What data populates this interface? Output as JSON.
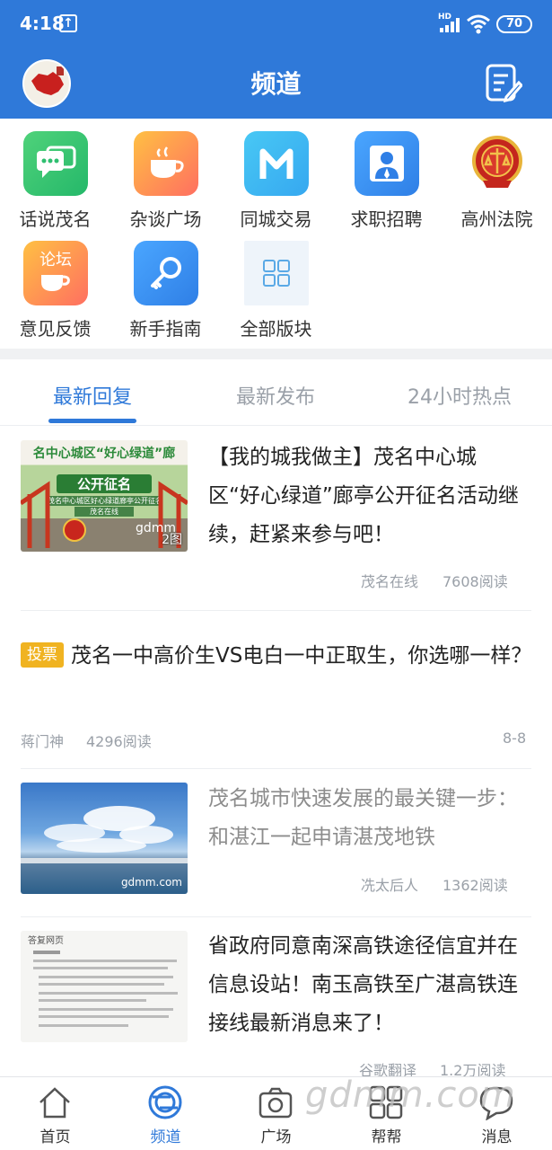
{
  "status_bar": {
    "time": "4:18",
    "network": "HD",
    "battery": "70"
  },
  "header": {
    "title": "频道"
  },
  "channels": [
    {
      "label": "话说茂名",
      "icon": "chat-bubbles-icon"
    },
    {
      "label": "杂谈广场",
      "icon": "coffee-cup-icon"
    },
    {
      "label": "同城交易",
      "icon": "m-logo-icon"
    },
    {
      "label": "求职招聘",
      "icon": "job-seeker-icon"
    },
    {
      "label": "高州法院",
      "icon": "court-emblem-icon"
    },
    {
      "label": "意见反馈",
      "icon": "forum-icon",
      "icon_text": "论坛"
    },
    {
      "label": "新手指南",
      "icon": "key-icon"
    },
    {
      "label": "全部版块",
      "icon": "grid-icon"
    }
  ],
  "tabs": [
    {
      "label": "最新回复",
      "active": true
    },
    {
      "label": "最新发布",
      "active": false
    },
    {
      "label": "24小时热点",
      "active": false
    }
  ],
  "feed": [
    {
      "title": "【我的城我做主】茂名中心城区“好心绿道”廊亭公开征名活动继续，赶紧来参与吧！",
      "author": "茂名在线",
      "reads": "7608阅读",
      "thumb": {
        "banner": "名中心城区“好心绿道”廊",
        "caption": "公开征名",
        "sub1": "茂名中心城区好心绿道廊亭公开征名",
        "sub2": "茂名在线",
        "watermark": "gdmm",
        "count": "2图"
      }
    },
    {
      "tag": "投票",
      "title": "茂名一中高价生VS电白一中正取生，你选哪一样？",
      "author": "蒋门神",
      "reads": "4296阅读",
      "date": "8-8"
    },
    {
      "title": "茂名城市快速发展的最关键一步：和湛江一起申请湛茂地铁",
      "author": "冼太后人",
      "reads": "1362阅读",
      "thumb": {
        "watermark": "gdmm.com"
      }
    },
    {
      "title": "省政府同意南深高铁途径信宜并在信息设站！南玉高铁至广湛高铁连接线最新消息来了！",
      "author": "谷歌翻译",
      "reads": "1.2万阅读",
      "thumb": {
        "heading": "答复网页"
      }
    }
  ],
  "bottom_nav": [
    {
      "label": "首页",
      "icon": "home-icon",
      "active": false
    },
    {
      "label": "频道",
      "icon": "channel-icon",
      "active": true
    },
    {
      "label": "广场",
      "icon": "camera-icon",
      "active": false
    },
    {
      "label": "帮帮",
      "icon": "apps-icon",
      "active": false
    },
    {
      "label": "消息",
      "icon": "message-icon",
      "active": false
    }
  ],
  "watermark": "gdmm.com",
  "colors": {
    "primary": "#2f79d9",
    "vote_tag": "#f0b321",
    "muted": "#9aa0a8"
  }
}
